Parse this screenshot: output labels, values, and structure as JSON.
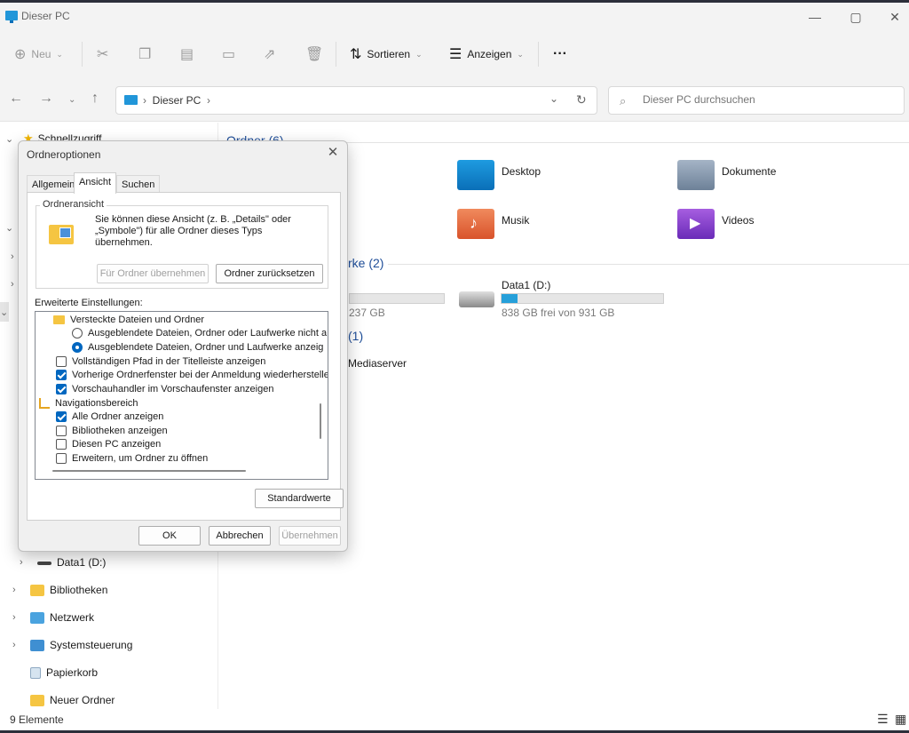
{
  "window": {
    "title": "Dieser PC",
    "minimize": "—",
    "maximize": "▢",
    "close": "✕"
  },
  "toolbar": {
    "new_label": "Neu",
    "sort_label": "Sortieren",
    "view_label": "Anzeigen",
    "more": "···"
  },
  "address": {
    "crumb": "Dieser PC",
    "search_placeholder": "Dieser PC durchsuchen"
  },
  "sidebar": {
    "quick_access": "Schnellzugriff",
    "items": [
      {
        "label": "Data1 (D:)"
      },
      {
        "label": "Bibliotheken"
      },
      {
        "label": "Netzwerk"
      },
      {
        "label": "Systemsteuerung"
      },
      {
        "label": "Papierkorb"
      },
      {
        "label": "Neuer Ordner"
      }
    ]
  },
  "content": {
    "folders_title": "Ordner (6)",
    "folders": [
      {
        "label": "Desktop"
      },
      {
        "label": "Dokumente"
      },
      {
        "label": "Musik"
      },
      {
        "label": "Videos"
      }
    ],
    "drives_title_fragment": "rke (2)",
    "drive0_free_fragment": "237 GB",
    "drive1": {
      "label": "Data1 (D:)",
      "free": "838 GB frei von 931 GB",
      "used_fraction": 0.1
    },
    "network_title_fragment": "(1)",
    "network_item_fragment": "Mediaserver"
  },
  "status": {
    "count": "9 Elemente"
  },
  "dialog": {
    "title": "Ordneroptionen",
    "tabs": [
      "Allgemein",
      "Ansicht",
      "Suchen"
    ],
    "active_tab": "Ansicht",
    "group_legend": "Ordneransicht",
    "group_desc": "Sie können diese Ansicht (z. B. „Details\" oder „Symbole\") für alle Ordner dieses Typs übernehmen.",
    "apply_to_folders": "Für Ordner übernehmen",
    "reset_folders": "Ordner zurücksetzen",
    "advanced_label": "Erweiterte Einstellungen:",
    "advanced_items": [
      {
        "label": "Versteckte Dateien und Ordner"
      },
      {
        "label": "Ausgeblendete Dateien, Ordner oder Laufwerke nicht a"
      },
      {
        "label": "Ausgeblendete Dateien, Ordner und Laufwerke anzeig"
      },
      {
        "label": "Vollständigen Pfad in der Titelleiste anzeigen"
      },
      {
        "label": "Vorherige Ordnerfenster bei der Anmeldung wiederherstellen"
      },
      {
        "label": "Vorschauhandler im Vorschaufenster anzeigen"
      },
      {
        "label": "Navigationsbereich"
      },
      {
        "label": "Alle Ordner anzeigen"
      },
      {
        "label": "Bibliotheken anzeigen"
      },
      {
        "label": "Diesen PC anzeigen"
      },
      {
        "label": "Erweitern, um Ordner zu öffnen"
      }
    ],
    "defaults": "Standardwerte",
    "ok": "OK",
    "cancel": "Abbrechen",
    "apply": "Übernehmen"
  }
}
